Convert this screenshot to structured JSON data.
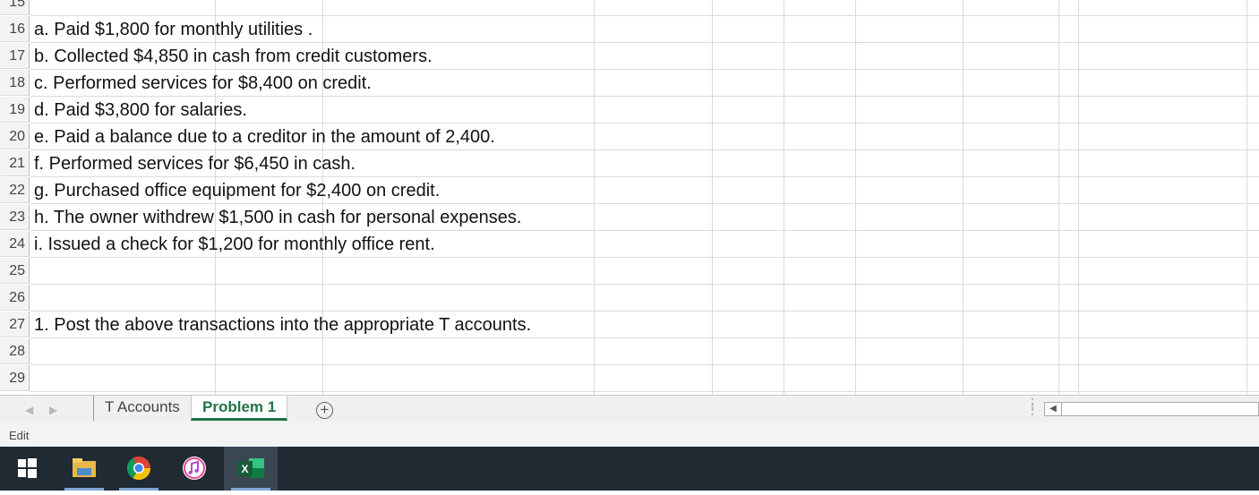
{
  "sheet": {
    "rows": [
      {
        "num": "15",
        "text": ""
      },
      {
        "num": "16",
        "text": "a. Paid $1,800 for monthly utilities ."
      },
      {
        "num": "17",
        "text": "b. Collected $4,850 in cash from credit customers."
      },
      {
        "num": "18",
        "text": "c. Performed services for $8,400 on credit."
      },
      {
        "num": "19",
        "text": "d. Paid $3,800 for salaries."
      },
      {
        "num": "20",
        "text": "e. Paid a balance due to a creditor in the amount of 2,400."
      },
      {
        "num": "21",
        "text": "f. Performed services for $6,450 in cash."
      },
      {
        "num": "22",
        "text": "g. Purchased office equipment for $2,400 on credit."
      },
      {
        "num": "23",
        "text": "h. The owner withdrew $1,500 in cash for personal expenses."
      },
      {
        "num": "24",
        "text": "i. Issued a check for $1,200 for monthly office rent."
      },
      {
        "num": "25",
        "text": ""
      },
      {
        "num": "26",
        "text": ""
      },
      {
        "num": "27",
        "text": "1. Post the above transactions into the appropriate T accounts."
      },
      {
        "num": "28",
        "text": ""
      },
      {
        "num": "29",
        "text": ""
      }
    ]
  },
  "tabs": {
    "items": [
      "T Accounts",
      "Problem 1"
    ],
    "active": "Problem 1",
    "add_icon": "plus-circle-icon"
  },
  "statusbar": {
    "mode": "Edit"
  },
  "taskbar": {
    "items": [
      "windows-start-icon",
      "file-explorer-icon",
      "chrome-icon",
      "itunes-icon",
      "excel-icon"
    ]
  },
  "colors": {
    "excel_green": "#217346",
    "taskbar": "#1f2a33",
    "grid": "#dadada"
  }
}
